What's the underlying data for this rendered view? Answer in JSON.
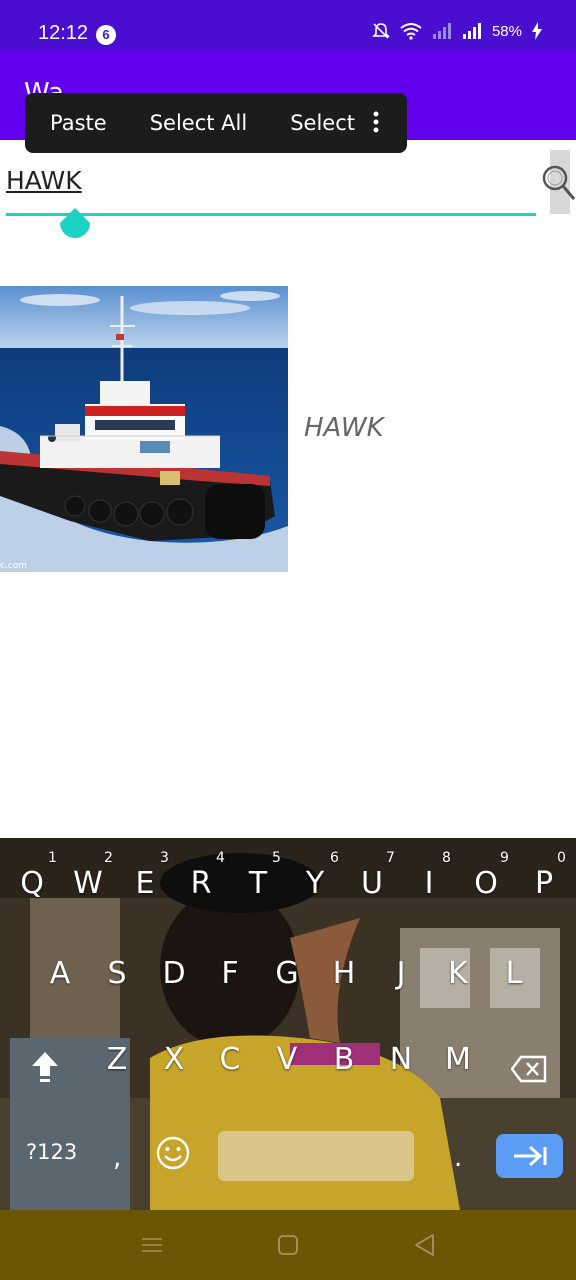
{
  "status": {
    "time": "12:12",
    "notification_count": "6",
    "battery": "58%"
  },
  "app": {
    "title": "Wa..."
  },
  "context_menu": {
    "items": [
      "Paste",
      "Select All",
      "Select"
    ]
  },
  "search": {
    "value": "HAWK"
  },
  "result": {
    "label": "HAWK",
    "image_watermark": "c.com"
  },
  "keyboard": {
    "numbers": [
      "1",
      "2",
      "3",
      "4",
      "5",
      "6",
      "7",
      "8",
      "9",
      "0"
    ],
    "row1": [
      "Q",
      "W",
      "E",
      "R",
      "T",
      "Y",
      "U",
      "I",
      "O",
      "P"
    ],
    "row2": [
      "A",
      "S",
      "D",
      "F",
      "G",
      "H",
      "J",
      "K",
      "L"
    ],
    "row3": [
      "Z",
      "X",
      "C",
      "V",
      "B",
      "N",
      "M"
    ],
    "symbols_key": "?123",
    "comma": ",",
    "period": "."
  },
  "colors": {
    "status_bar": "#4a0ed1",
    "app_bar": "#6200ee",
    "accent": "#1dd1c4",
    "nav_bar": "#6b5606",
    "enter_key": "#5b9cf5"
  }
}
